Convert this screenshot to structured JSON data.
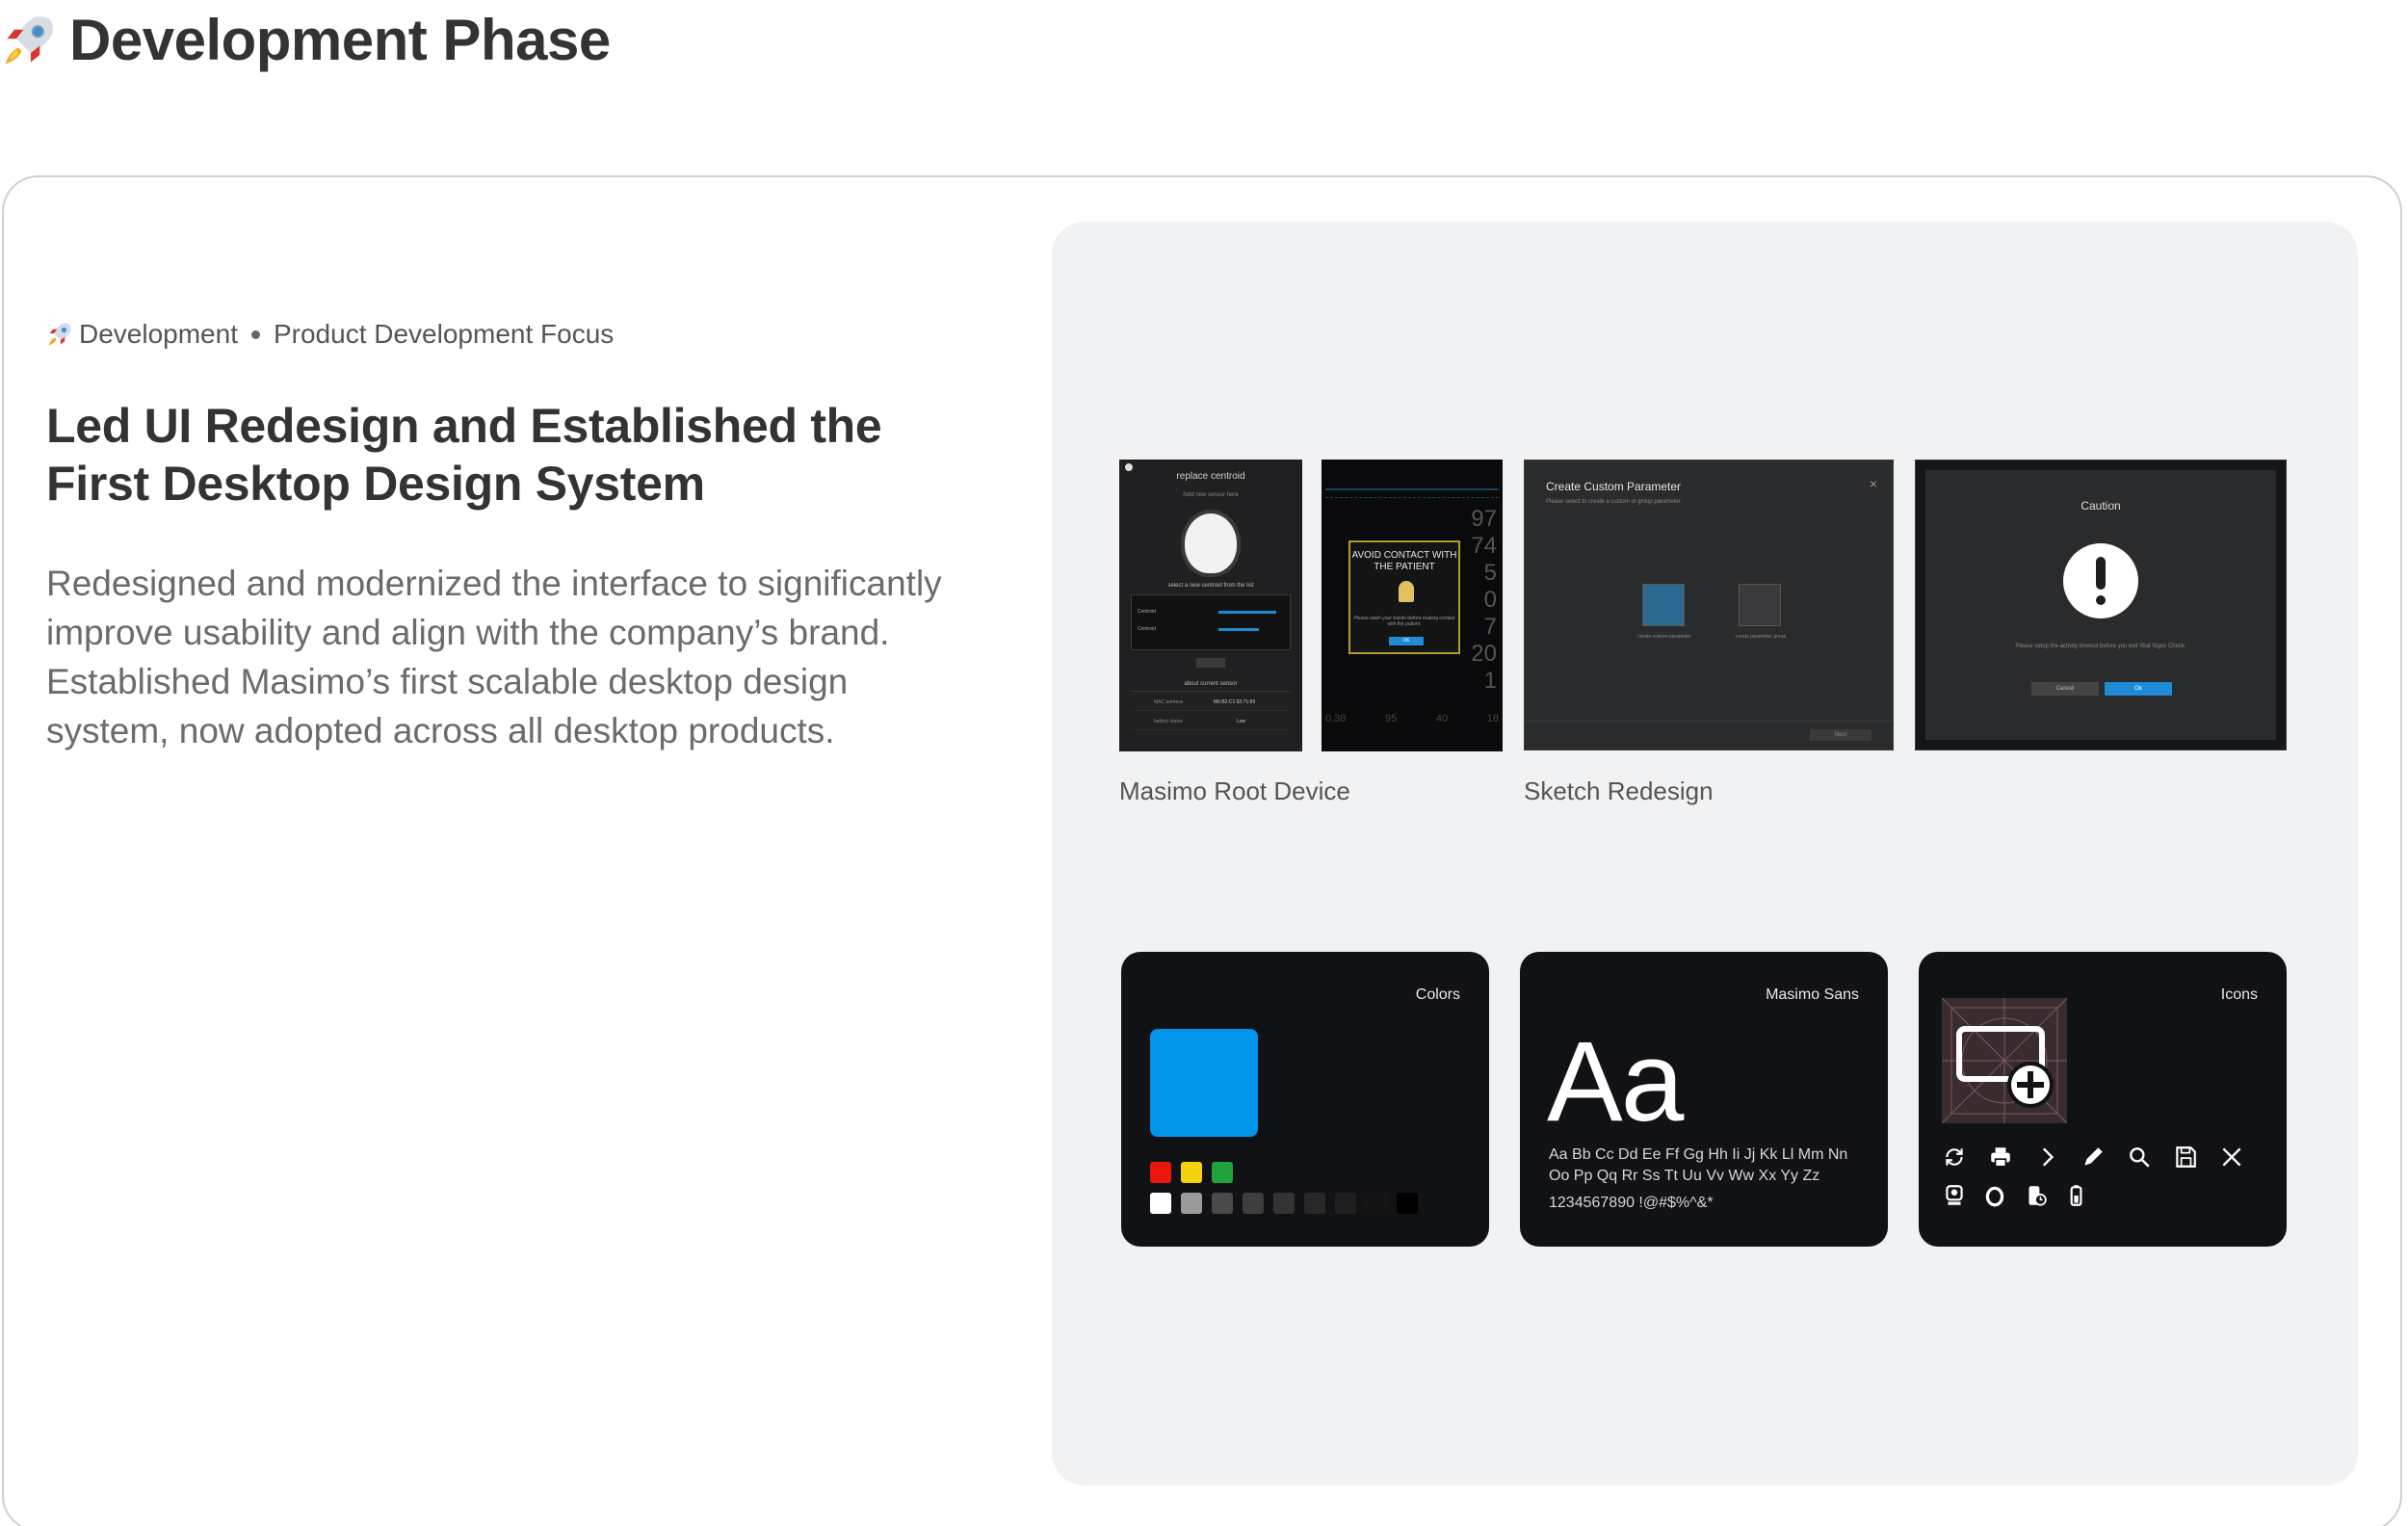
{
  "page": {
    "title": "Development Phase",
    "title_icon": "rocket-icon"
  },
  "card": {
    "meta": {
      "icon": "rocket-icon",
      "category": "Development",
      "focus": "Product Development Focus"
    },
    "headline": "Led UI Redesign and Established the First Desktop Design System",
    "description": "Redesigned and modernized the interface to significantly improve usability and align with the company’s brand. Established Masimo’s first scalable desktop design system, now adopted across all desktop products."
  },
  "gallery": {
    "captions": {
      "root": "Masimo Root Device",
      "sketch": "Sketch Redesign"
    },
    "root_device_1": {
      "title": "replace centroid",
      "subtitle": "hold new sensor here",
      "select": "select a new centroid from the list",
      "row1": "Centroid",
      "row2": "Centroid",
      "about": "about current sensor",
      "mac_label": "MAC address",
      "mac_value": "M6:B2:C1:92:71:69",
      "battery_label": "battery status",
      "battery_value": "Low"
    },
    "root_device_2": {
      "alert_title": "AVOID CONTACT WITH THE PATIENT",
      "alert_msg": "Please wash your hands before making contact with the patient.",
      "ok": "OK",
      "vitals": [
        "97",
        "74",
        "5",
        "0",
        "7",
        "20",
        "1"
      ],
      "bottom": [
        "0.38",
        "95",
        "40",
        "18"
      ]
    },
    "sketch_1": {
      "title": "Create Custom Parameter",
      "subtitle": "Please select to create a custom or group parameter.",
      "opt1": "create custom parameter",
      "opt2": "create parameter group",
      "next": "Next"
    },
    "sketch_2": {
      "title": "Caution",
      "message": "Please setup the activity timeout before you exit Vital Signs Check.",
      "cancel": "Cancel",
      "ok": "Ok"
    }
  },
  "design_system": {
    "colors": {
      "label": "Colors",
      "primary": "#0095ea",
      "row1": [
        "#e8160c",
        "#f4d20b",
        "#1fa33a"
      ],
      "row2": [
        "#ffffff",
        "#9a9a9a",
        "#4a4a4a",
        "#3e3e3e",
        "#333333",
        "#282828",
        "#1e1e1e",
        "#141414",
        "#000000"
      ]
    },
    "typography": {
      "label": "Masimo Sans",
      "sample": "Aa",
      "alphabet": "Aa Bb Cc Dd Ee Ff Gg Hh Ii Jj Kk Ll Mm Nn Oo Pp Qq Rr Ss Tt Uu Vv Ww Xx Yy Zz",
      "digits": "1234567890  !@#$%^&*"
    },
    "icons": {
      "label": "Icons",
      "row1": [
        "refresh-icon",
        "print-icon",
        "chevron-right-icon",
        "pencil-icon",
        "search-icon",
        "save-icon",
        "close-icon"
      ],
      "row2": [
        "sensor-icon",
        "ring-icon",
        "device-clock-icon",
        "battery-icon"
      ]
    }
  }
}
